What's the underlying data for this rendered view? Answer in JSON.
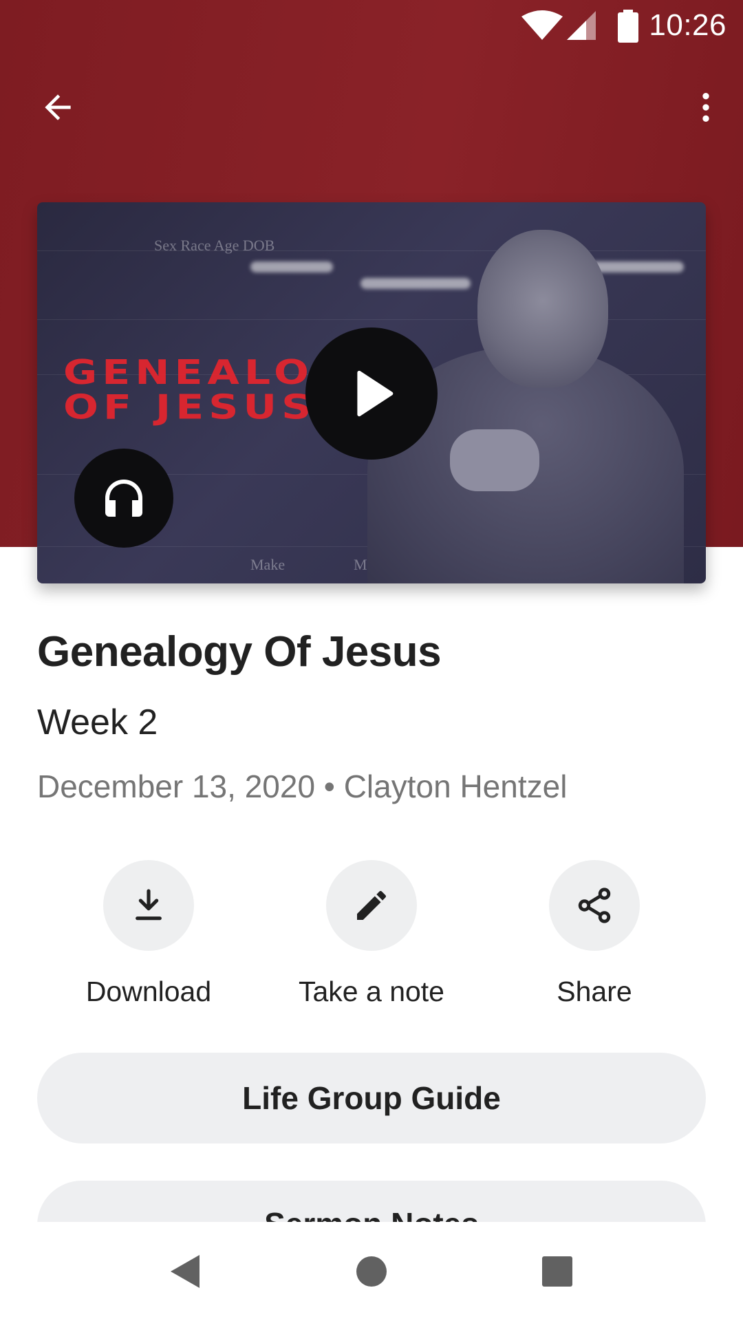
{
  "status_bar": {
    "time": "10:26"
  },
  "toolbar": {
    "back_icon": "arrow-left-icon",
    "more_icon": "more-vert-icon"
  },
  "video": {
    "overlay_title_line1": "GENEALOGY",
    "overlay_title_line2": "OF JESUS",
    "play_icon": "play-icon",
    "audio_icon": "headphones-icon"
  },
  "sermon": {
    "title": "Genealogy Of Jesus",
    "subtitle": "Week 2",
    "meta": "December 13, 2020 • Clayton Hentzel"
  },
  "actions": [
    {
      "label": "Download",
      "icon": "download-icon"
    },
    {
      "label": "Take a note",
      "icon": "pencil-icon"
    },
    {
      "label": "Share",
      "icon": "share-icon"
    }
  ],
  "buttons": {
    "life_group_guide": "Life Group Guide",
    "sermon_notes": "Sermon Notes"
  },
  "colors": {
    "header": "#8a2228",
    "pill": "#eeeff1",
    "text": "#212121",
    "meta": "#757575"
  }
}
